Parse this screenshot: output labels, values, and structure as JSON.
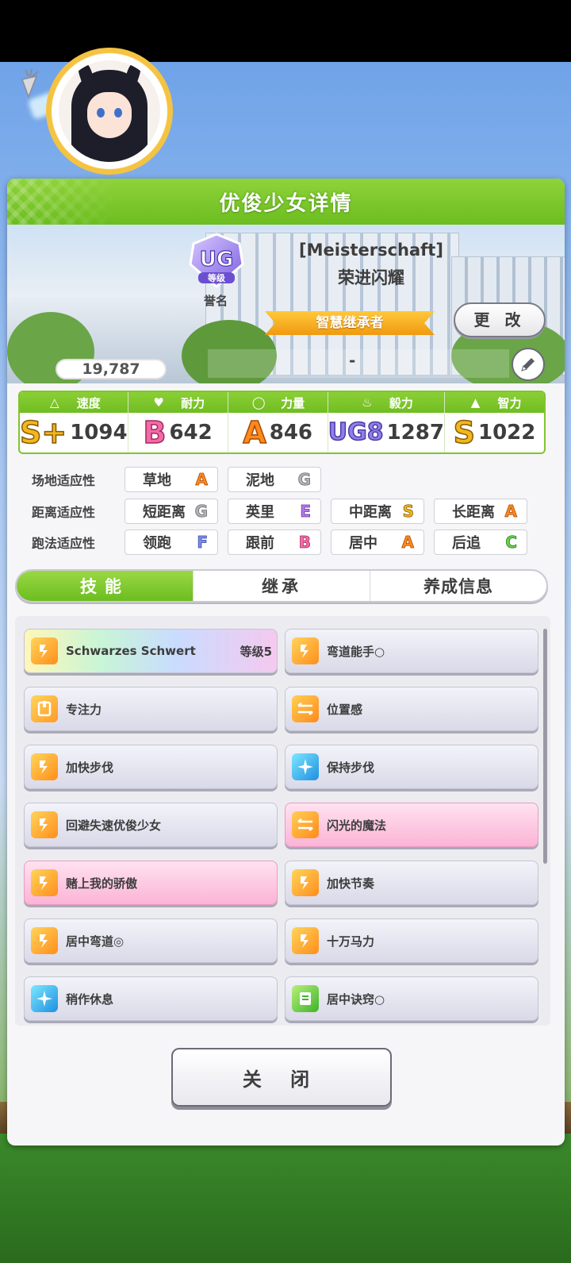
{
  "header": {
    "title": "优俊少女详情"
  },
  "profile": {
    "fans": "19,787",
    "rank_badge": "UG",
    "rank_sub": "等级",
    "rank_label": "誉名",
    "title_en": "[Meisterschaft]",
    "name": "荣进闪耀",
    "epithet": "智慧继承者",
    "change_label": "更 改",
    "subtitle": "-"
  },
  "stats": [
    {
      "label": "速度",
      "icon": "shoe-icon",
      "grade": "S+",
      "value": "1094"
    },
    {
      "label": "耐力",
      "icon": "heart-icon",
      "grade": "B",
      "value": "642"
    },
    {
      "label": "力量",
      "icon": "muscle-icon",
      "grade": "A",
      "value": "846"
    },
    {
      "label": "毅力",
      "icon": "flame-icon",
      "grade": "UG8",
      "value": "1287"
    },
    {
      "label": "智力",
      "icon": "graduation-cap-icon",
      "grade": "S",
      "value": "1022"
    }
  ],
  "aptitude": {
    "track": {
      "label": "场地适应性",
      "items": [
        {
          "name": "草地",
          "grade": "A"
        },
        {
          "name": "泥地",
          "grade": "G"
        }
      ]
    },
    "distance": {
      "label": "距离适应性",
      "items": [
        {
          "name": "短距离",
          "grade": "G"
        },
        {
          "name": "英里",
          "grade": "E"
        },
        {
          "name": "中距离",
          "grade": "S"
        },
        {
          "name": "长距离",
          "grade": "A"
        }
      ]
    },
    "strategy": {
      "label": "跑法适应性",
      "items": [
        {
          "name": "领跑",
          "grade": "F"
        },
        {
          "name": "跟前",
          "grade": "B"
        },
        {
          "name": "居中",
          "grade": "A"
        },
        {
          "name": "后追",
          "grade": "C"
        }
      ]
    }
  },
  "tabs": [
    "技能",
    "继承",
    "养成信息"
  ],
  "skills": [
    {
      "name": "Schwarzes Schwert",
      "level": "等级5",
      "icon": "speed-skill-icon"
    },
    {
      "name": "弯道能手○",
      "icon": "speed-skill-icon"
    },
    {
      "name": "专注力",
      "icon": "focus-skill-icon"
    },
    {
      "name": "位置感",
      "icon": "position-skill-icon"
    },
    {
      "name": "加快步伐",
      "icon": "speed-skill-icon"
    },
    {
      "name": "保持步伐",
      "icon": "recovery-skill-icon"
    },
    {
      "name": "回避失速优俊少女",
      "icon": "speed-skill-icon"
    },
    {
      "name": "闪光的魔法",
      "icon": "position-skill-icon"
    },
    {
      "name": "赌上我的骄傲",
      "icon": "speed-skill-icon"
    },
    {
      "name": "加快节奏",
      "icon": "speed-skill-icon"
    },
    {
      "name": "居中弯道◎",
      "icon": "speed-skill-icon"
    },
    {
      "name": "十万马力",
      "icon": "speed-skill-icon"
    },
    {
      "name": "稍作休息",
      "icon": "recovery-skill-icon"
    },
    {
      "name": "居中诀窍○",
      "icon": "green-skill-icon"
    }
  ],
  "close_label": "关 闭",
  "colors": {
    "accent_green": "#6cbd1f",
    "ribbon_orange": "#f09a10",
    "gold_skill": "#fbb4d6"
  }
}
